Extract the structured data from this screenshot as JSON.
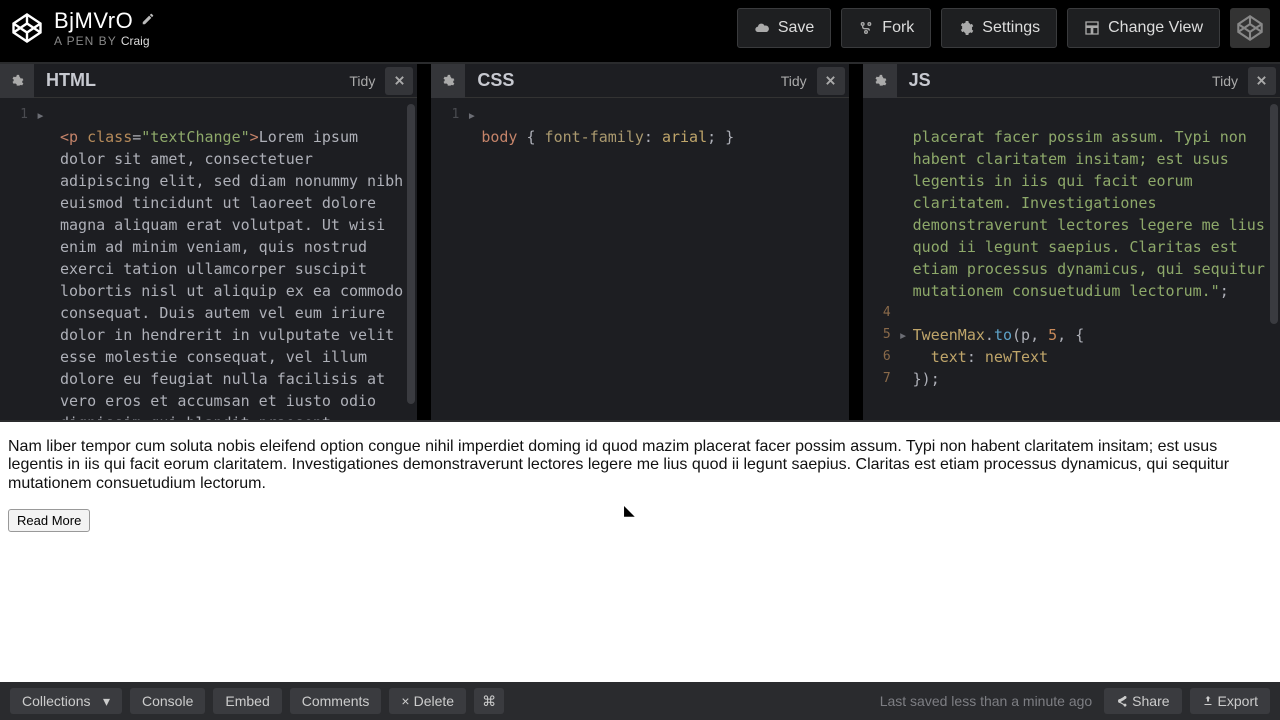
{
  "header": {
    "title": "BjMVrO",
    "subtitle_prefix": "A PEN BY ",
    "author": "Craig",
    "buttons": {
      "save": "Save",
      "fork": "Fork",
      "settings": "Settings",
      "change_view": "Change View"
    }
  },
  "panes": {
    "html": {
      "title": "HTML",
      "tidy": "Tidy",
      "line_numbers": [
        "1"
      ]
    },
    "css": {
      "title": "CSS",
      "tidy": "Tidy",
      "line_numbers": [
        "1"
      ]
    },
    "js": {
      "title": "JS",
      "tidy": "Tidy",
      "line_numbers": [
        "",
        "",
        "",
        "4",
        "5",
        "6",
        "7"
      ]
    }
  },
  "code": {
    "html": {
      "tag_open": "<p",
      "attr_name": " class",
      "eq": "=",
      "attr_val": "\"textChange\"",
      "gt": ">",
      "text": "Lorem ipsum dolor sit amet, consectetuer adipiscing elit, sed diam nonummy nibh euismod tincidunt ut laoreet dolore magna aliquam erat volutpat. Ut wisi enim ad minim veniam, quis nostrud exerci tation ullamcorper suscipit lobortis nisl ut aliquip ex ea commodo consequat. Duis autem vel eum iriure dolor in hendrerit in vulputate velit esse molestie consequat, vel illum dolore eu feugiat nulla facilisis at vero eros et accumsan et iusto odio dignissim qui blandit praesent luptatum zzril delenit augue duis dolore te"
    },
    "css": {
      "selector": "body",
      "open": " { ",
      "prop": "font-family",
      "colon": ": ",
      "val": "arial",
      "semi": ";",
      "close": " }"
    },
    "js": {
      "string_tail": "placerat facer possim assum. Typi non habent claritatem insitam; est usus legentis in iis qui facit eorum claritatem. Investigationes demonstraverunt lectores legere me lius quod ii legunt saepius. Claritas est etiam processus dynamicus, qui sequitur mutationem consuetudium lectorum.\"",
      "string_end": ";",
      "l5_obj": "TweenMax",
      "l5_dot": ".",
      "l5_fn": "to",
      "l5_open": "(",
      "l5_arg1": "p",
      "l5_c1": ", ",
      "l5_num": "5",
      "l5_c2": ", {",
      "l6_prop": "text",
      "l6_colon": ": ",
      "l6_val": "newText",
      "l7": "});"
    }
  },
  "preview": {
    "paragraph": "Nam liber tempor cum soluta nobis eleifend option congue nihil imperdiet doming id quod mazim placerat facer possim assum. Typi non habent claritatem insitam; est usus legentis in iis qui facit eorum claritatem. Investigationes demonstraverunt lectores legere me lius quod ii legunt saepius. Claritas est etiam processus dynamicus, qui sequitur mutationem consuetudium lectorum.",
    "button": "Read More"
  },
  "footer": {
    "collections": "Collections",
    "console": "Console",
    "embed": "Embed",
    "comments": "Comments",
    "delete": "Delete",
    "shortcut": "⌘",
    "status": "Last saved less than a minute ago",
    "share": "Share",
    "export": "Export"
  }
}
